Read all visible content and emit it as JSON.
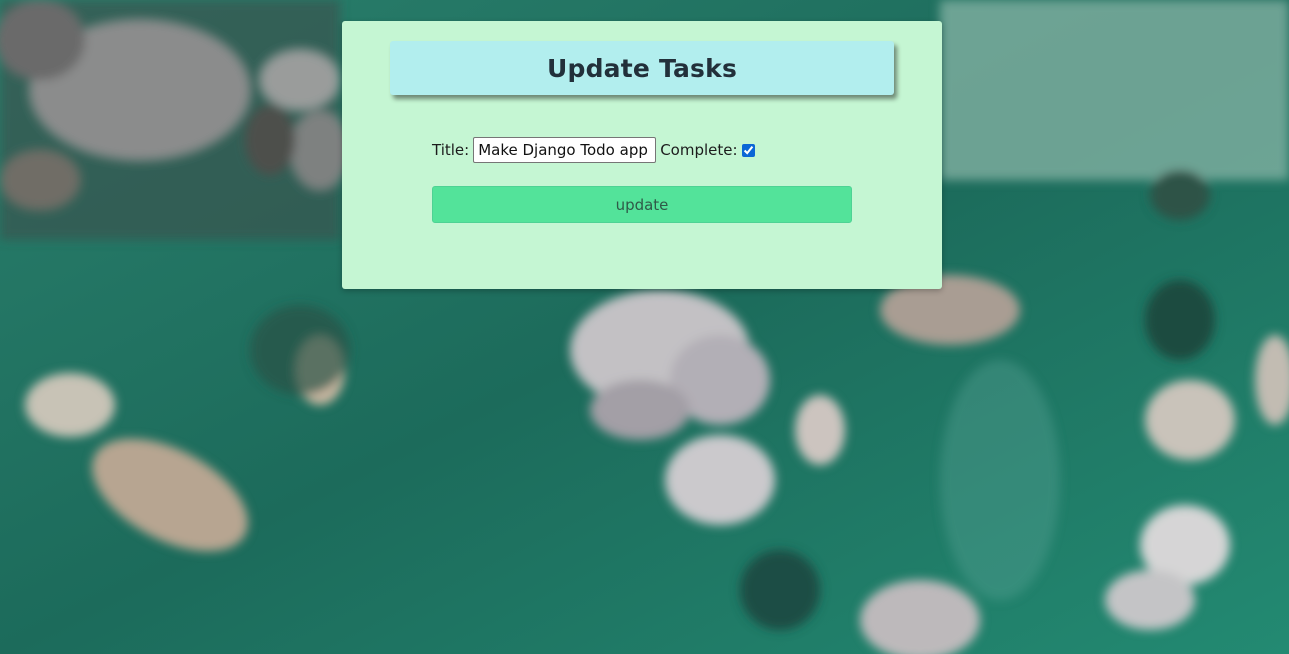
{
  "page": {
    "heading": "Update Tasks"
  },
  "form": {
    "title_label": "Title:",
    "title_value": "Make Django Todo app",
    "complete_label": "Complete:",
    "complete_checked": true,
    "submit_label": "update"
  },
  "colors": {
    "card_background": "#c5f6d3",
    "header_background": "#b2eeee",
    "button_background": "#53e39a",
    "page_background": "#1f6d5f"
  }
}
